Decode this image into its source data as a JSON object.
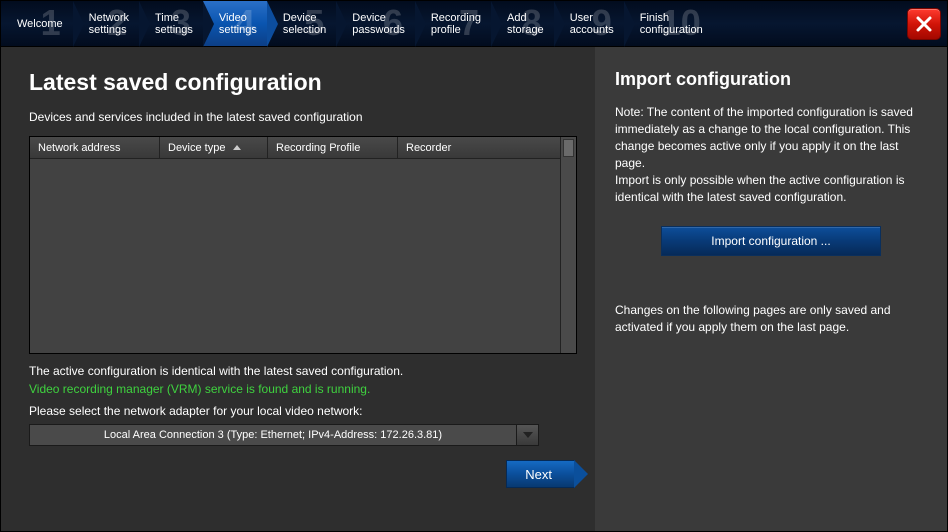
{
  "steps": [
    {
      "num": "1",
      "line1": "Welcome",
      "line2": ""
    },
    {
      "num": "2",
      "line1": "Network",
      "line2": "settings"
    },
    {
      "num": "3",
      "line1": "Time",
      "line2": "settings"
    },
    {
      "num": "4",
      "line1": "Video",
      "line2": "settings"
    },
    {
      "num": "5",
      "line1": "Device",
      "line2": "selection"
    },
    {
      "num": "6",
      "line1": "Device",
      "line2": "passwords"
    },
    {
      "num": "7",
      "line1": "Recording",
      "line2": "profile"
    },
    {
      "num": "8",
      "line1": "Add",
      "line2": "storage"
    },
    {
      "num": "9",
      "line1": "User",
      "line2": "accounts"
    },
    {
      "num": "10",
      "line1": "Finish",
      "line2": "configuration"
    }
  ],
  "active_step_index": 3,
  "left": {
    "title": "Latest saved configuration",
    "subtitle": "Devices and services included in the latest saved configuration",
    "columns": {
      "c0": "Network address",
      "c1": "Device type",
      "c2": "Recording Profile",
      "c3": "Recorder"
    },
    "status_identical": "The active configuration is identical with the latest saved configuration.",
    "status_vrm": "Video recording manager (VRM) service is found and is running.",
    "select_label": "Please select the network adapter for your local video network:",
    "adapter_selected": "Local Area Connection 3 (Type: Ethernet; IPv4-Address: 172.26.3.81)",
    "next_label": "Next"
  },
  "right": {
    "title": "Import configuration",
    "note": "Note: The content of the imported configuration is saved immediately as a change to the local configuration. This change becomes active only if you apply it on the last page.\nImport is only possible when the active configuration is identical with the latest saved configuration.",
    "import_btn": "Import configuration ...",
    "bottom_note": "Changes on the following pages are only saved and activated if you apply them on the last page."
  }
}
